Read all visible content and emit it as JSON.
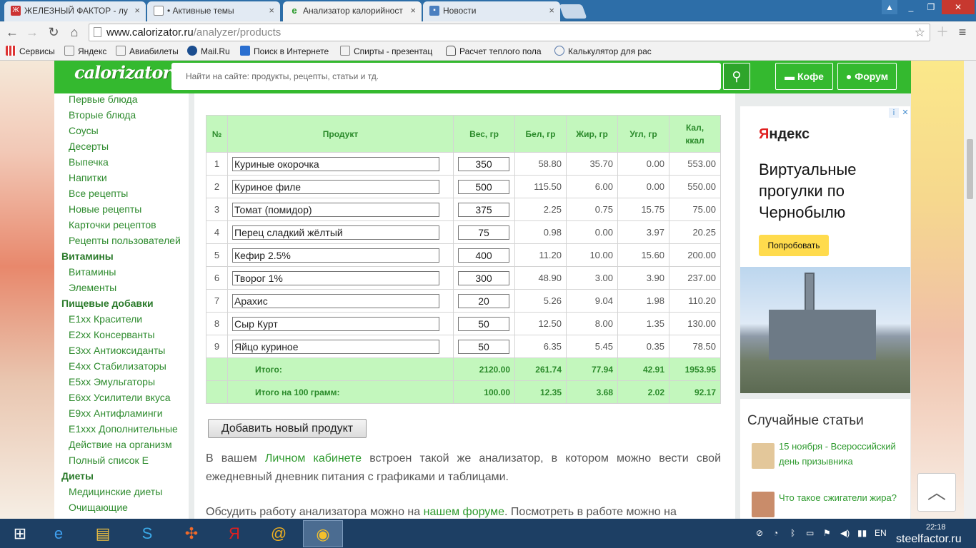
{
  "browser": {
    "tabs": [
      {
        "label": "ЖЕЛЕЗНЫЙ ФАКТОР - лу",
        "icon": "site-icon"
      },
      {
        "label": "• Активные темы",
        "icon": "page-icon"
      },
      {
        "label": "Анализатор калорийност",
        "icon": "calorizator-icon"
      },
      {
        "label": "Новости",
        "icon": "news-icon"
      }
    ],
    "url_host": "www.calorizator.ru",
    "url_path": "/analyzer/products",
    "bookmarks": [
      "Сервисы",
      "Яндекс",
      "Авиабилеты",
      "Mail.Ru",
      "Поиск в Интернете",
      "Спирты - презентац",
      "Расчет теплого пола",
      "Калькулятор для рас"
    ]
  },
  "site": {
    "logo": "calorizator",
    "search_placeholder": "Найти на сайте: продукты, рецепты, статьи и тд.",
    "coffee_label": "Кофе",
    "forum_label": "Форум",
    "accent": "#34b92f",
    "header_bg": "#c3f7bd"
  },
  "sidebar": [
    {
      "label": "Первые блюда",
      "cat": false
    },
    {
      "label": "Вторые блюда",
      "cat": false
    },
    {
      "label": "Соусы",
      "cat": false
    },
    {
      "label": "Десерты",
      "cat": false
    },
    {
      "label": "Выпечка",
      "cat": false
    },
    {
      "label": "Напитки",
      "cat": false
    },
    {
      "label": "Все рецепты",
      "cat": false
    },
    {
      "label": "Новые рецепты",
      "cat": false
    },
    {
      "label": "Карточки рецептов",
      "cat": false
    },
    {
      "label": "Рецепты пользователей",
      "cat": false
    },
    {
      "label": "Витамины",
      "cat": true
    },
    {
      "label": "Витамины",
      "cat": false
    },
    {
      "label": "Элементы",
      "cat": false
    },
    {
      "label": "Пищевые добавки",
      "cat": true
    },
    {
      "label": "E1xx Красители",
      "cat": false
    },
    {
      "label": "E2xx Консерванты",
      "cat": false
    },
    {
      "label": "E3xx Антиоксиданты",
      "cat": false
    },
    {
      "label": "E4xx Стабилизаторы",
      "cat": false
    },
    {
      "label": "E5xx Эмульгаторы",
      "cat": false
    },
    {
      "label": "E6xx Усилители вкуса",
      "cat": false
    },
    {
      "label": "E9xx Антифламинги",
      "cat": false
    },
    {
      "label": "E1xxx Дополнительные",
      "cat": false
    },
    {
      "label": "Действие на организм",
      "cat": false
    },
    {
      "label": "Полный список Е",
      "cat": false
    },
    {
      "label": "Диеты",
      "cat": true
    },
    {
      "label": "Медицинские диеты",
      "cat": false
    },
    {
      "label": "Очищающие",
      "cat": false
    }
  ],
  "table": {
    "headers": {
      "no": "№",
      "product": "Продукт",
      "weight": "Вес, гр",
      "protein": "Бел, гр",
      "fat": "Жир, гр",
      "carbs": "Угл, гр",
      "kcal_1": "Кал,",
      "kcal_2": "ккал"
    },
    "rows": [
      {
        "no": "1",
        "product": "Куриные окорочка",
        "weight": "350",
        "protein": "58.80",
        "fat": "35.70",
        "carbs": "0.00",
        "kcal": "553.00"
      },
      {
        "no": "2",
        "product": "Куриное филе",
        "weight": "500",
        "protein": "115.50",
        "fat": "6.00",
        "carbs": "0.00",
        "kcal": "550.00"
      },
      {
        "no": "3",
        "product": "Томат (помидор)",
        "weight": "375",
        "protein": "2.25",
        "fat": "0.75",
        "carbs": "15.75",
        "kcal": "75.00"
      },
      {
        "no": "4",
        "product": "Перец сладкий жёлтый",
        "weight": "75",
        "protein": "0.98",
        "fat": "0.00",
        "carbs": "3.97",
        "kcal": "20.25"
      },
      {
        "no": "5",
        "product": "Кефир 2.5%",
        "weight": "400",
        "protein": "11.20",
        "fat": "10.00",
        "carbs": "15.60",
        "kcal": "200.00"
      },
      {
        "no": "6",
        "product": "Творог 1%",
        "weight": "300",
        "protein": "48.90",
        "fat": "3.00",
        "carbs": "3.90",
        "kcal": "237.00"
      },
      {
        "no": "7",
        "product": "Арахис",
        "weight": "20",
        "protein": "5.26",
        "fat": "9.04",
        "carbs": "1.98",
        "kcal": "110.20"
      },
      {
        "no": "8",
        "product": "Сыр Курт",
        "weight": "50",
        "protein": "12.50",
        "fat": "8.00",
        "carbs": "1.35",
        "kcal": "130.00"
      },
      {
        "no": "9",
        "product": "Яйцо куриное",
        "weight": "50",
        "protein": "6.35",
        "fat": "5.45",
        "carbs": "0.35",
        "kcal": "78.50"
      }
    ],
    "total": {
      "label": "Итого:",
      "weight": "2120.00",
      "protein": "261.74",
      "fat": "77.94",
      "carbs": "42.91",
      "kcal": "1953.95"
    },
    "per100": {
      "label": "Итого на 100 грамм:",
      "weight": "100.00",
      "protein": "12.35",
      "fat": "3.68",
      "carbs": "2.02",
      "kcal": "92.17"
    }
  },
  "add_button": "Добавить новый продукт",
  "para1": {
    "pre": "В вашем ",
    "link": "Личном кабинете",
    "post": " встроен такой же анализатор, в котором можно вести свой ежедневный дневник питания с графиками и таблицами."
  },
  "para2": {
    "pre": "Обсудить работу анализатора можно на ",
    "link": "нашем форуме",
    "post": ". Посмотреть в работе можно на"
  },
  "ad": {
    "brand_1": "Я",
    "brand_2": "ндекс",
    "text": "Виртуальные прогулки по Чернобылю",
    "button": "Попробовать"
  },
  "random": {
    "title": "Случайные статьи",
    "items": [
      "15 ноября - Всероссийский день призывника",
      "Что такое сжигатели жира?"
    ]
  },
  "taskbar": {
    "time": "22:18",
    "watermark": "steelfactor.ru"
  }
}
